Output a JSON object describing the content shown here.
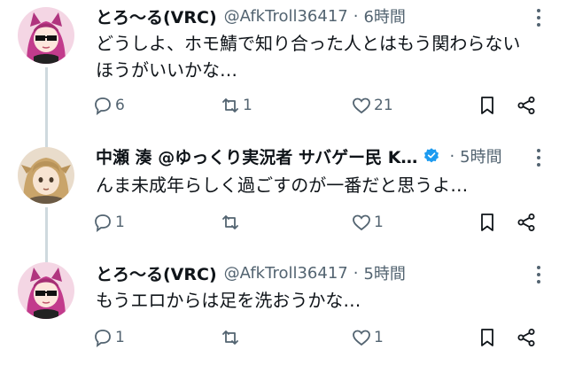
{
  "tweets": [
    {
      "name": "とろ〜る(VRC)",
      "handle": "@AfkTroll36417",
      "time": "6時間",
      "lines": [
        "どうしよ、ホモ鯖で知り合った人とはもう関わらない",
        "ほうがいいかな…"
      ],
      "replies": "6",
      "retweets": "1",
      "likes": "21",
      "avatar": "pink-haired-anime-girl-with-sunglasses"
    },
    {
      "name": "中瀬 湊 @ゆっくり実況者 サバゲー民 K…",
      "handle": "",
      "time": "5時間",
      "verified": true,
      "lines": [
        "んま未成年らしく過ごすのが一番だと思うよ…"
      ],
      "replies": "1",
      "retweets": "",
      "likes": "1",
      "avatar": "blonde-anime-character"
    },
    {
      "name": "とろ〜る(VRC)",
      "handle": "@AfkTroll36417",
      "time": "5時間",
      "lines": [
        "もうエロからは足を洗おうかな…"
      ],
      "replies": "1",
      "retweets": "",
      "likes": "1",
      "avatar": "pink-haired-anime-girl-with-sunglasses"
    }
  ],
  "header_separator": "·",
  "icons": {
    "reply": "reply-icon",
    "retweet": "retweet-icon",
    "like": "like-icon",
    "bookmark": "bookmark-icon",
    "share": "share-icon",
    "more": "more-icon",
    "verified": "verified-badge-icon"
  },
  "colors": {
    "text": "#0f1419",
    "secondary": "#536471",
    "thread_line": "#cfd9de",
    "verified": "#1d9bf0"
  }
}
